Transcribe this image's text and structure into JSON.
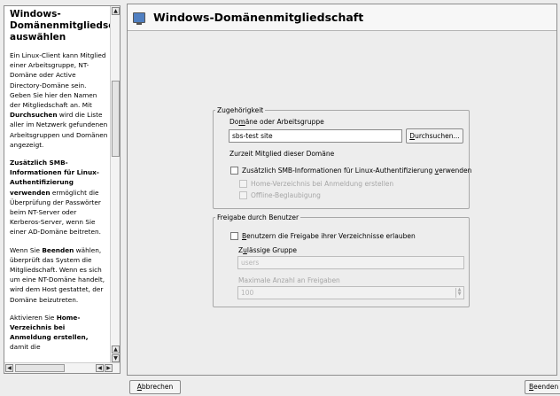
{
  "help": {
    "title": "Windows-Domänenmitgliedschaft auswählen",
    "p1": "Ein Linux-Client kann Mitglied einer Arbeitsgruppe, NT-Domäne oder Active Directory-Domäne sein. Geben Sie hier den Namen der Mitgliedschaft an. Mit ",
    "p1_bold": "Durchsuchen",
    "p1_rest": " wird die Liste aller im Netzwerk gefundenen Arbeitsgruppen und Domänen angezeigt.",
    "p2_bold": "Zusätzlich SMB-Informationen für Linux-Authentifizierung verwenden",
    "p2_rest": " ermöglicht die Überprüfung der Passwörter beim NT-Server oder Kerberos-Server, wenn Sie einer AD-Domäne beitreten.",
    "p3_a": "Wenn Sie ",
    "p3_bold": "Beenden",
    "p3_rest": " wählen, überprüft das System die Mitgliedschaft. Wenn es sich um eine NT-Domäne handelt, wird dem Host gestattet, der Domäne beizutreten.",
    "p4_a": "Aktivieren Sie ",
    "p4_bold": "Home-Verzeichnis bei Anmeldung erstellen,",
    "p4_rest": " damit die"
  },
  "header": {
    "title": "Windows-Domänenmitgliedschaft"
  },
  "membership": {
    "legend": "Zugehörigkeit",
    "field_label_pre": "Do",
    "field_label_u": "m",
    "field_label_post": "äne oder Arbeitsgruppe",
    "field_value": "sbs-test site",
    "browse_u": "D",
    "browse_rest": "urchsuchen...",
    "current_text": "Zurzeit Mitglied dieser Domäne",
    "smb_pre": "Zusätzlich SMB-Informationen für Linux-Authentifizierung ",
    "smb_u": "v",
    "smb_post": "erwenden",
    "home_dir": "Home-Verzeichnis bei Anmeldung erstellen",
    "offline": "Offline-Beglaubigung"
  },
  "sharing": {
    "legend": "Freigabe durch Benutzer",
    "allow_u": "B",
    "allow_rest": "enutzern die Freigabe ihrer Verzeichnisse erlauben",
    "group_label_pre": "Z",
    "group_label_u": "u",
    "group_label_post": "lässige Gruppe",
    "group_value": "users",
    "max_label": "Maximale Anzahl an Freigaben",
    "max_value": "100"
  },
  "footer": {
    "cancel_u": "A",
    "cancel_rest": "bbrechen",
    "finish_u": "B",
    "finish_rest": "eenden"
  }
}
